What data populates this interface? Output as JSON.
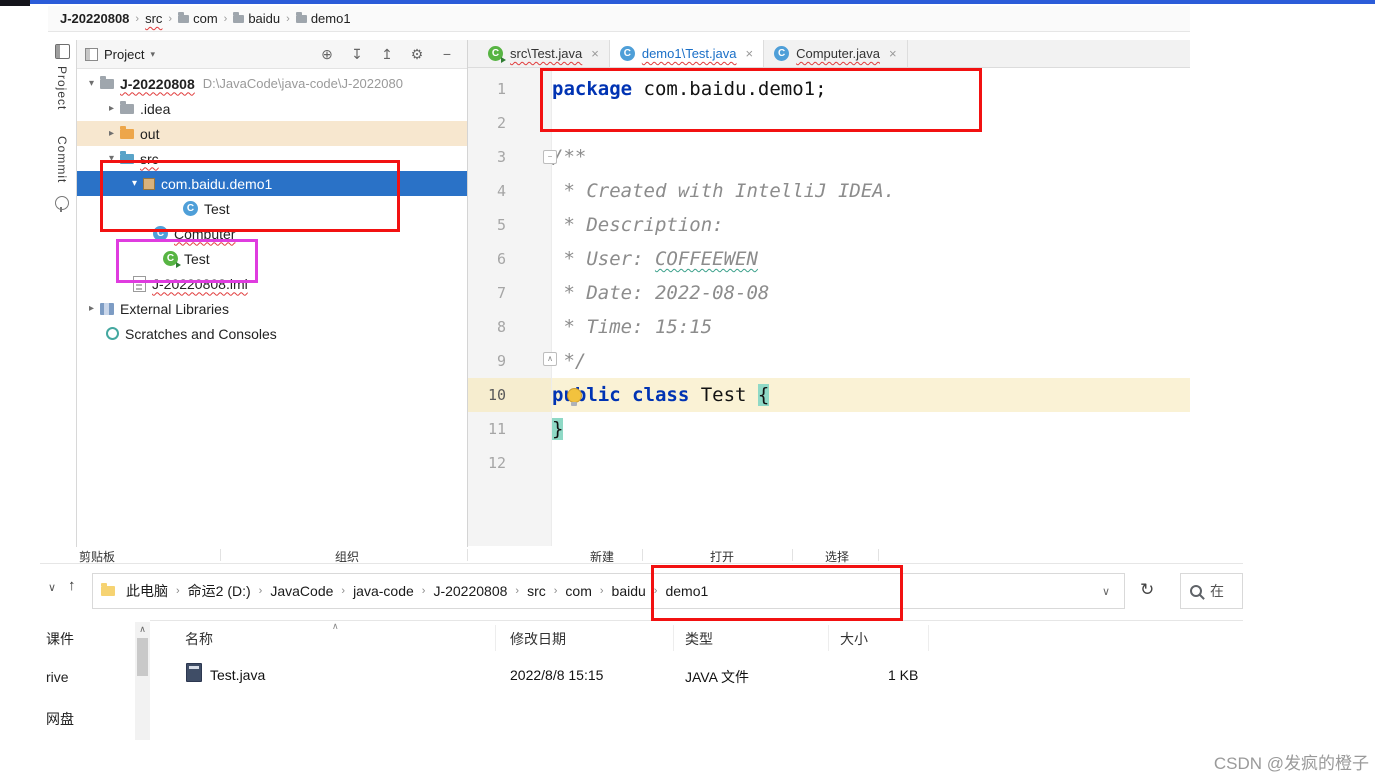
{
  "icons": {
    "class_letter": "C"
  },
  "ide_breadcrumb": {
    "separator": "›",
    "items": [
      "J-20220808",
      "src",
      "com",
      "baidu",
      "demo1"
    ]
  },
  "tool_stripe": {
    "project_label": "Project",
    "commit_label": "Commit"
  },
  "project_panel": {
    "title": "Project",
    "title_chevron": "▾",
    "glyphs": {
      "expanded": "▾",
      "collapsed": "▸"
    },
    "header_icons": {
      "locate": "⊕",
      "expand_all": "↧",
      "collapse_all": "↥",
      "settings": "⚙",
      "hide": "−"
    },
    "tree": {
      "root_label": "J-20220808",
      "root_path": "D:\\JavaCode\\java-code\\J-2022080",
      "items": [
        ".idea",
        "out",
        "src",
        "com.baidu.demo1",
        "Test",
        "Computer",
        "Test",
        "J-20220808.iml",
        "External Libraries",
        "Scratches and Consoles"
      ]
    }
  },
  "editor": {
    "tab_close": "×",
    "tabs": [
      {
        "label": "src\\Test.java"
      },
      {
        "label": "demo1\\Test.java"
      },
      {
        "label": "Computer.java"
      }
    ],
    "glyphs": {
      "fold_minus": "−",
      "fold_up": "∧"
    },
    "line_numbers": [
      "1",
      "2",
      "3",
      "4",
      "5",
      "6",
      "7",
      "8",
      "9",
      "10",
      "11",
      "12"
    ],
    "code": {
      "l1_kw": "package",
      "l1_rest": " com.baidu.demo1;",
      "l3": "/**",
      "l4": " * Created with IntelliJ IDEA.",
      "l5": " * Description:",
      "l6_pre": " * User: ",
      "l6_user": "COFFEEWEN",
      "l7": " * Date: 2022-08-08",
      "l8": " * Time: 15:15",
      "l9": " */",
      "l10_kw1": "public ",
      "l10_kw2": "class",
      "l10_rest": " Test ",
      "l10_brace": "{",
      "l11_brace": "}"
    }
  },
  "explorer": {
    "ribbon_labels": [
      "剪贴板",
      "组织",
      "新建",
      "打开",
      "选择"
    ],
    "nav": {
      "chevron": "∨",
      "up": "↑",
      "refresh": "↻",
      "address_chevron": "∨"
    },
    "address_separator": "›",
    "address_crumbs": [
      "此电脑",
      "命运2 (D:)",
      "JavaCode",
      "java-code",
      "J-20220808",
      "src",
      "com",
      "baidu",
      "demo1"
    ],
    "search_text": "在",
    "sidebar_items": [
      "课件",
      "rive",
      "网盘"
    ],
    "list": {
      "sort_indicator": "∧",
      "columns": [
        "名称",
        "修改日期",
        "类型",
        "大小"
      ],
      "rows": [
        {
          "name": "Test.java",
          "modified": "2022/8/8 15:15",
          "type": "JAVA 文件",
          "size": "1 KB"
        }
      ]
    }
  },
  "watermark": "CSDN @发疯的橙子"
}
